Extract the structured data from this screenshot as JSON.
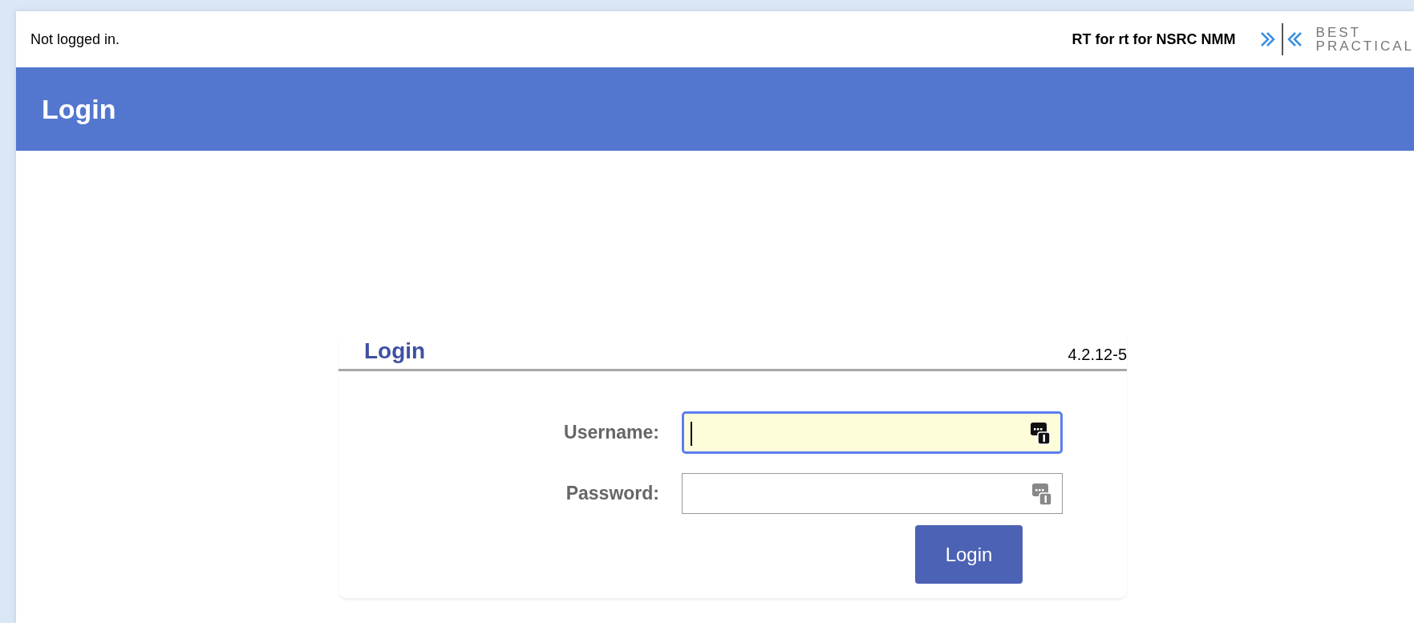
{
  "top_bar": {
    "status": "Not logged in.",
    "site_name": "RT for rt for NSRC NMM",
    "logo": {
      "line_1": "BEST",
      "line_2": "PRACTICAL"
    }
  },
  "header": {
    "title": "Login"
  },
  "login_box": {
    "title": "Login",
    "version": "4.2.12-5",
    "fields": [
      {
        "label": "Username:",
        "focused": true
      },
      {
        "label": "Password:",
        "focused": false
      }
    ],
    "button": "Login"
  }
}
